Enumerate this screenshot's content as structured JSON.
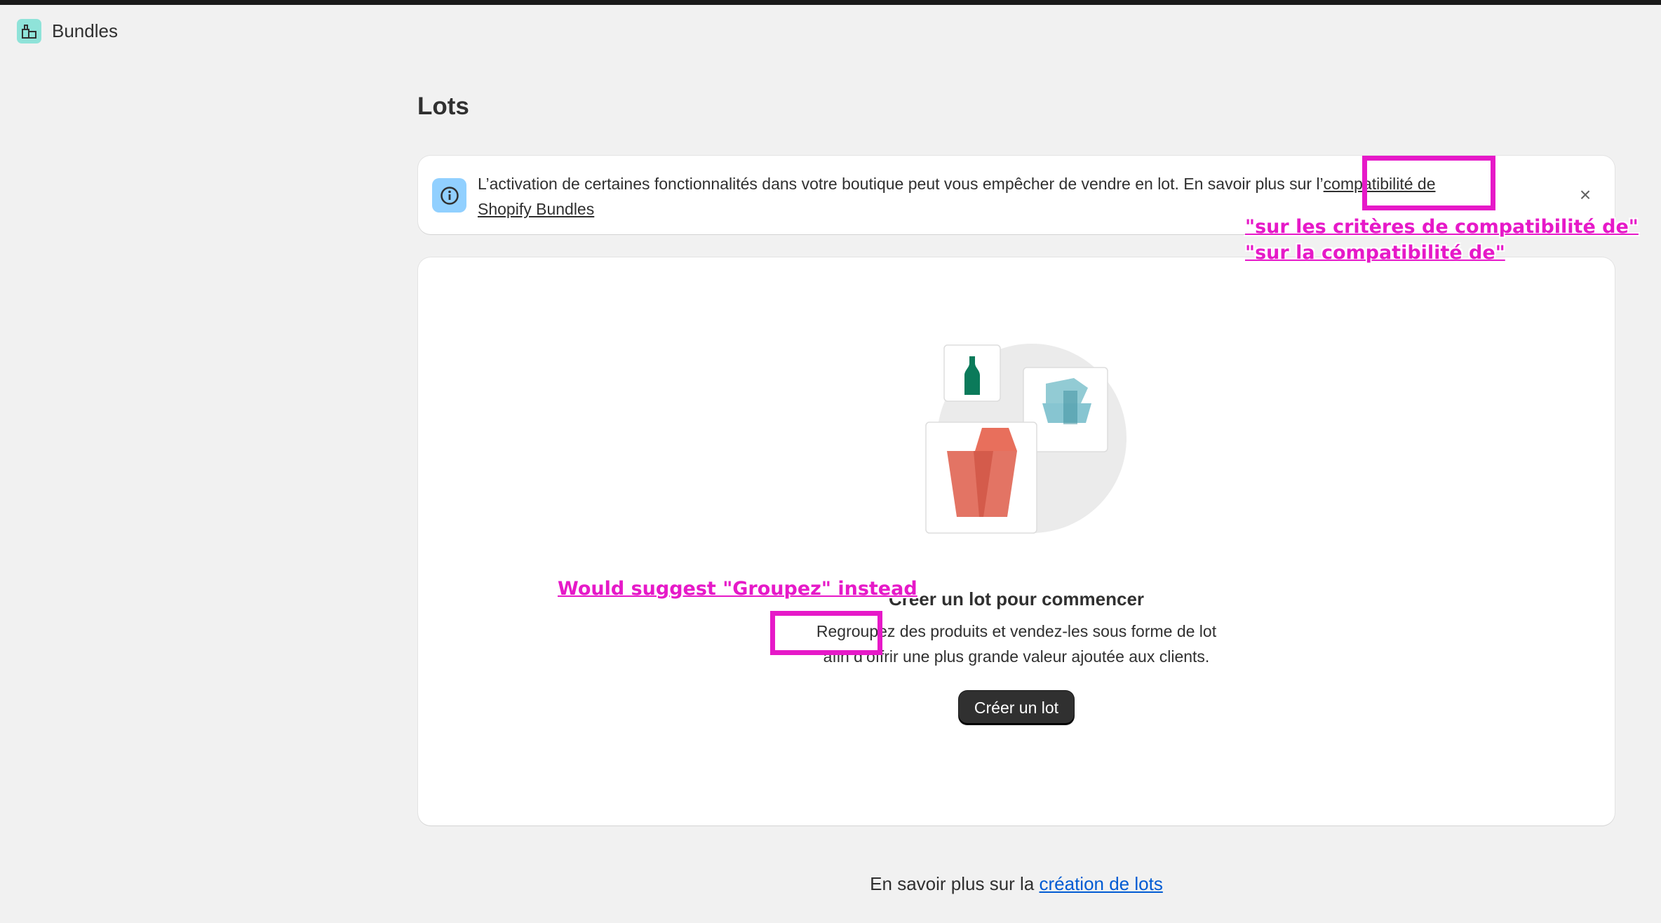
{
  "app": {
    "title": "Bundles",
    "icon": "bundles-app-icon"
  },
  "page": {
    "title": "Lots"
  },
  "banner": {
    "text_before": "L’activation de certaines fonctionnalités dans votre boutique peut vous empêcher de vendre en lot. En savoir plus sur l’",
    "link_text": "compatibilité de Shopify Bundles",
    "icon": "info-icon",
    "close_icon": "close-icon"
  },
  "empty_state": {
    "heading": "Créer un lot pour commencer",
    "body": "Regroupez des produits et vendez-les sous forme de lot afin d’offrir une plus grande valeur ajoutée aux clients.",
    "button_label": "Créer un lot"
  },
  "footer": {
    "text": "En savoir plus sur la ",
    "link_text": "création de lots"
  },
  "annotations": {
    "banner_suggestion_1": "\"sur les critères de compatibilité de\"",
    "banner_suggestion_2": "\"sur la compatibilité de\"",
    "body_suggestion": "Would suggest \"Groupez\" instead",
    "color": "#e619c8"
  },
  "colors": {
    "primary_button": "#303030",
    "link": "#005bd3",
    "info_icon_bg": "#91d0ff",
    "app_icon_bg": "#8fe3d9",
    "illustration_green": "#0b7a5a",
    "illustration_teal": "#5fb2c1",
    "illustration_red": "#e06553"
  }
}
